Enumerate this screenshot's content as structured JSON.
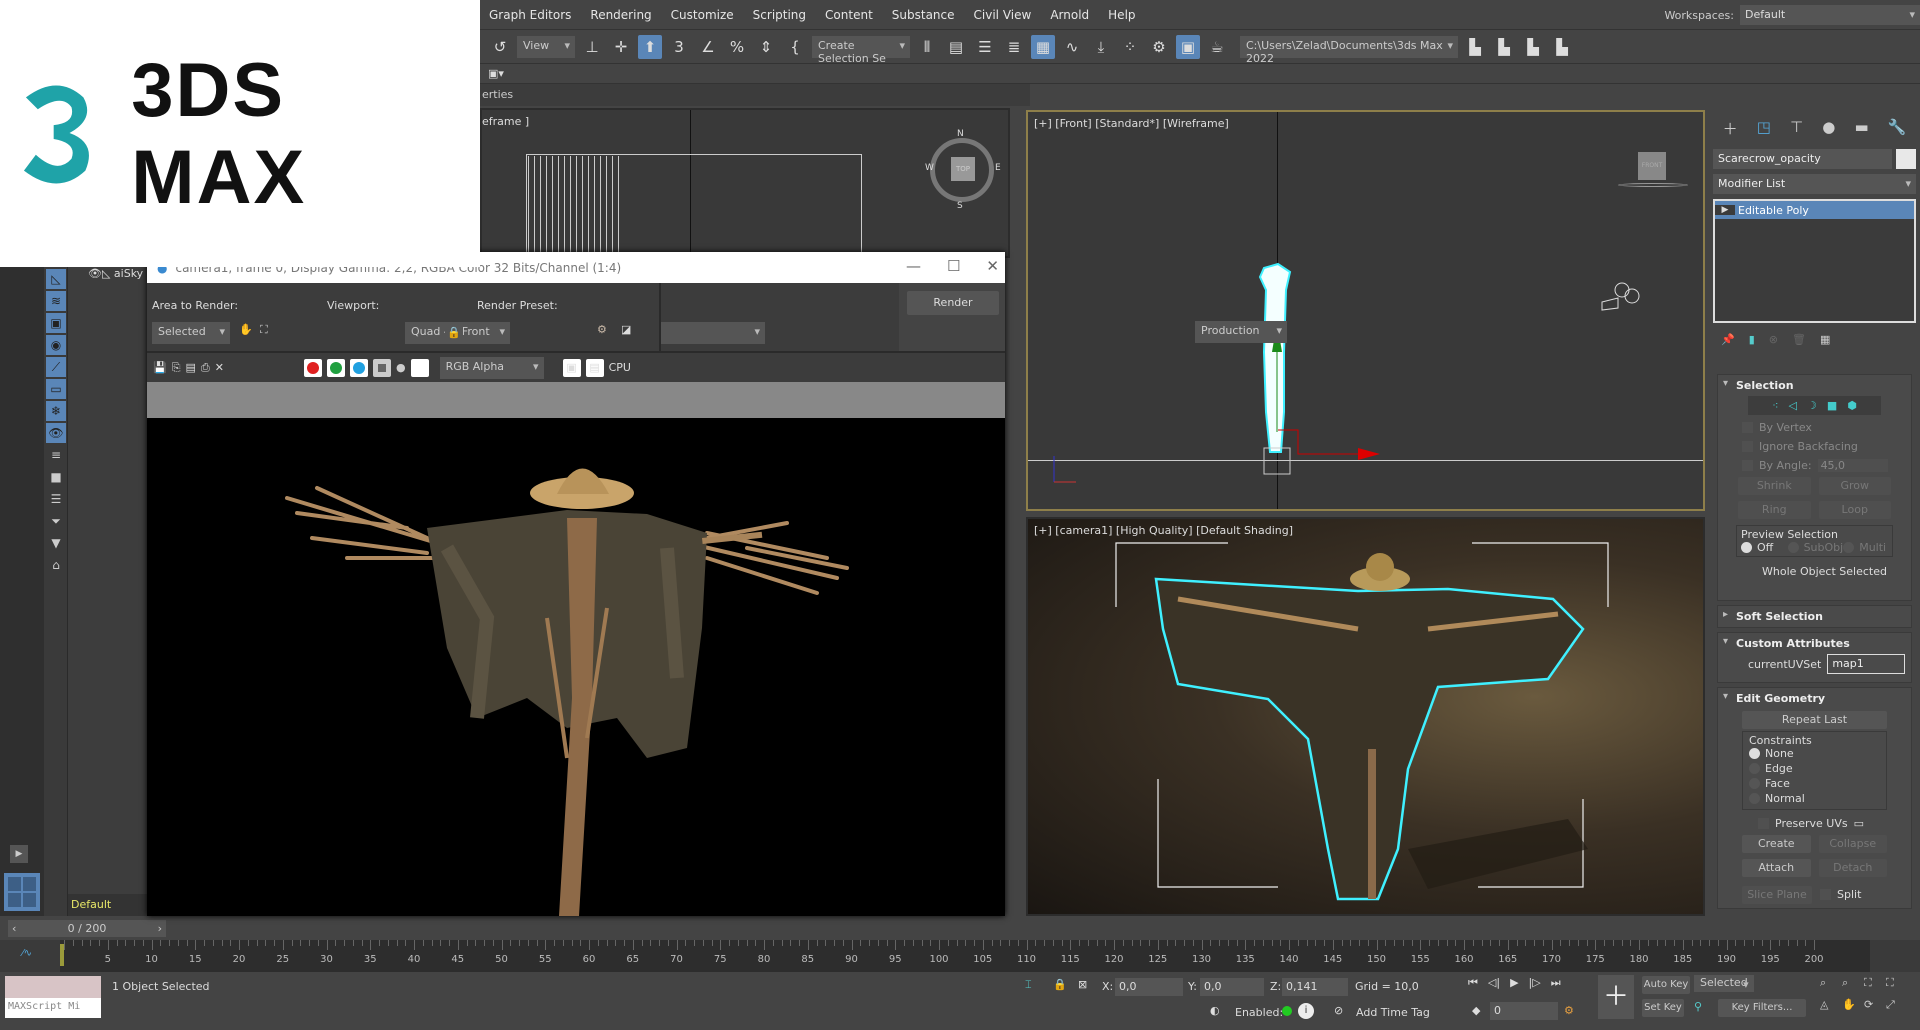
{
  "logo": {
    "text": "3DS MAX"
  },
  "menu": [
    "Graph Editors",
    "Rendering",
    "Customize",
    "Scripting",
    "Content",
    "Substance",
    "Civil View",
    "Arnold",
    "Help"
  ],
  "workspaces": {
    "label": "Workspaces:",
    "value": "Default"
  },
  "toolbar": {
    "view": "View",
    "selection_set": "Create Selection Se",
    "project_path": "C:\\Users\\Zelad\\Documents\\3ds Max 2022"
  },
  "panel_tab": "erties",
  "viewports": {
    "top_left": "eframe ]",
    "front": "[+] [Front] [Standard*] [Wireframe]",
    "camera": "[+] [camera1] [High Quality] [Default Shading]",
    "front_cube": "FRONT",
    "compass": {
      "n": "N",
      "s": "S",
      "e": "E",
      "w": "W",
      "cube": "TOP"
    }
  },
  "explorer": {
    "item": "aiSky",
    "layer": "Default"
  },
  "render_window": {
    "title": "camera1, frame 0, Display Gamma: 2,2, RGBA Color 32 Bits/Channel (1:4)",
    "area_label": "Area to Render:",
    "area_value": "Selected",
    "viewport_label": "Viewport:",
    "viewport_value": "Quad 4 - Front",
    "preset_label": "Render Preset:",
    "preset_value": "",
    "render_btn": "Render",
    "mode": "Production",
    "channel": "RGB Alpha",
    "device": "CPU"
  },
  "command_panel": {
    "object_name": "Scarecrow_opacity",
    "modifier_list": "Modifier List",
    "stack": [
      "Editable Poly"
    ],
    "selection": {
      "title": "Selection",
      "by_vertex": "By Vertex",
      "ignore_backfacing": "Ignore Backfacing",
      "by_angle": "By Angle:",
      "angle": "45,0",
      "shrink": "Shrink",
      "grow": "Grow",
      "ring": "Ring",
      "loop": "Loop",
      "preview": "Preview Selection",
      "off": "Off",
      "subobj": "SubObj",
      "multi": "Multi",
      "status": "Whole Object Selected"
    },
    "soft_selection": "Soft Selection",
    "custom_attributes": {
      "title": "Custom Attributes",
      "label": "currentUVSet",
      "value": "map1"
    },
    "edit_geometry": {
      "title": "Edit Geometry",
      "repeat": "Repeat Last",
      "constraints": "Constraints",
      "none": "None",
      "edge": "Edge",
      "face": "Face",
      "normal": "Normal",
      "preserve": "Preserve UVs",
      "create": "Create",
      "collapse": "Collapse",
      "attach": "Attach",
      "detach": "Detach",
      "slice": "Slice Plane",
      "split": "Split"
    }
  },
  "timeline": {
    "frame": "0 / 200",
    "ticks": [
      "5",
      "10",
      "15",
      "20",
      "25",
      "30",
      "35",
      "40",
      "45",
      "50",
      "55",
      "60",
      "65",
      "70",
      "75",
      "80",
      "85",
      "90",
      "95",
      "100",
      "105",
      "110",
      "115",
      "120",
      "125",
      "130",
      "135",
      "140",
      "145",
      "150",
      "155",
      "160",
      "165",
      "170",
      "175",
      "180",
      "185",
      "190",
      "195",
      "200"
    ]
  },
  "status": {
    "maxscript": "MAXScript Mi",
    "selected": "1 Object Selected",
    "x_label": "X:",
    "x": "0,0",
    "y_label": "Y:",
    "y": "0,0",
    "z_label": "Z:",
    "z": "0,141",
    "grid": "Grid = 10,0",
    "enabled": "Enabled:",
    "time_tag": "Add Time Tag",
    "frame": "0",
    "auto_key": "Auto Key",
    "set_key": "Set Key",
    "key_mode": "Selected",
    "key_filters": "Key Filters..."
  },
  "colors": {
    "accent": "#5a86b8",
    "viewport_active": "#8e7f4a",
    "selection": "#3ff0ff"
  }
}
